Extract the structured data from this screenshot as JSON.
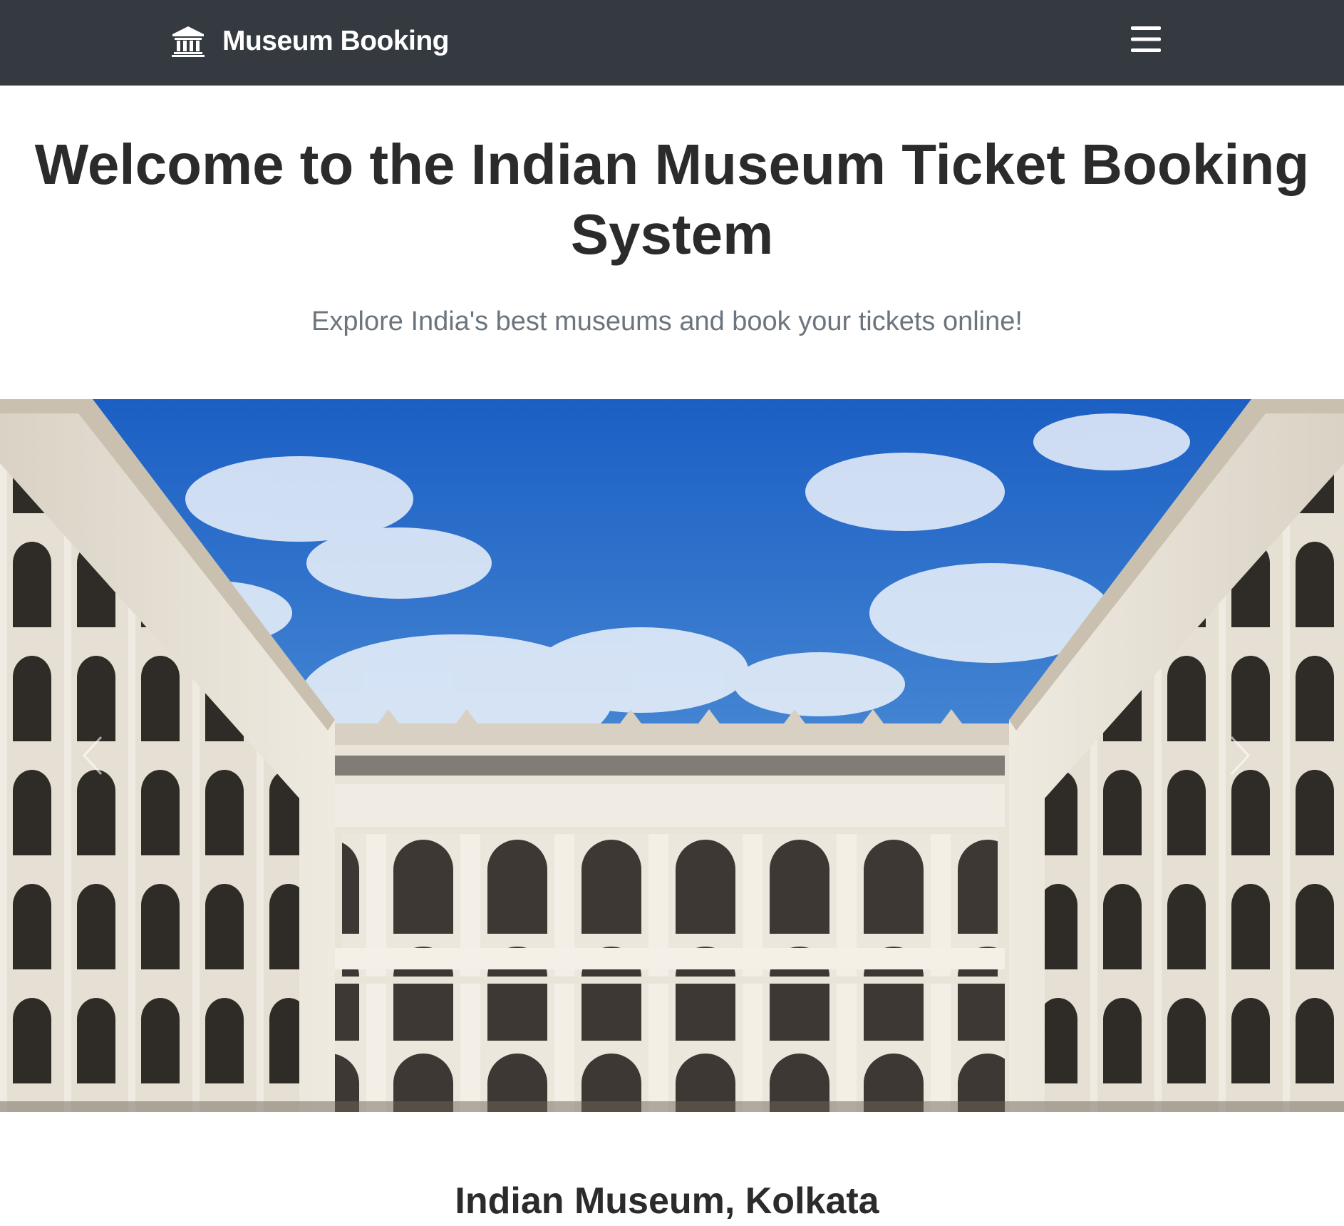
{
  "navbar": {
    "brand_text": "Museum Booking",
    "brand_icon": "museum-building-icon",
    "menu_icon": "hamburger-menu-icon",
    "background": "#343a40"
  },
  "hero": {
    "title": "Welcome to the Indian Museum Ticket Booking System",
    "subtitle": "Explore India's best museums and book your tickets online!"
  },
  "carousel": {
    "image_subject": "Indian Museum courtyard with arched colonnades under a blue sky",
    "prev_icon": "chevron-left-icon",
    "next_icon": "chevron-right-icon"
  },
  "featured": {
    "heading": "Indian Museum, Kolkata"
  }
}
